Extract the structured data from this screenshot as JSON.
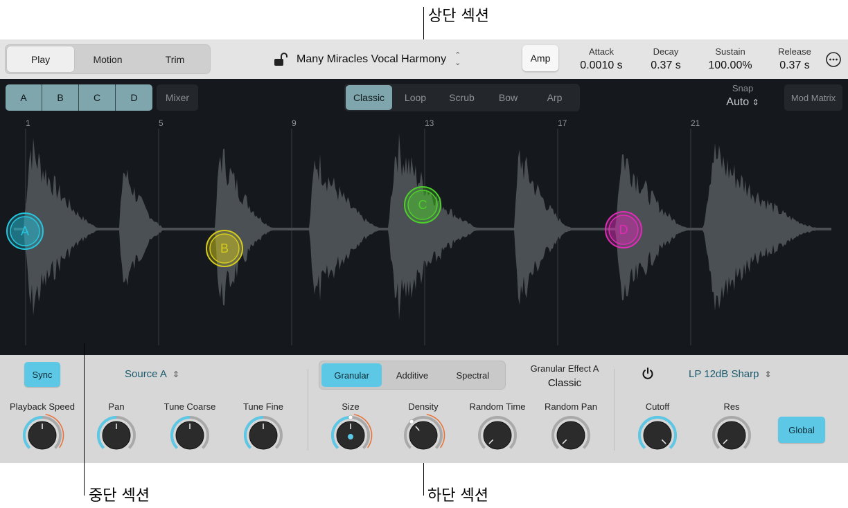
{
  "callouts": {
    "top": "상단 섹션",
    "middle": "중단 섹션",
    "bottom": "하단 섹션"
  },
  "topbar": {
    "modes": [
      "Play",
      "Motion",
      "Trim"
    ],
    "active_mode": "Play",
    "preset_name": "Many Miracles Vocal Harmony",
    "amp_label": "Amp",
    "params": [
      {
        "label": "Attack",
        "value": "0.0010 s"
      },
      {
        "label": "Decay",
        "value": "0.37 s"
      },
      {
        "label": "Sustain",
        "value": "100.00%"
      },
      {
        "label": "Release",
        "value": "0.37 s"
      }
    ]
  },
  "middle": {
    "sources": [
      "A",
      "B",
      "C",
      "D"
    ],
    "mixer_label": "Mixer",
    "play_modes": [
      "Classic",
      "Loop",
      "Scrub",
      "Bow",
      "Arp"
    ],
    "active_play_mode": "Classic",
    "snap_label": "Snap",
    "snap_value": "Auto",
    "mod_matrix_label": "Mod Matrix",
    "ruler": [
      "1",
      "5",
      "9",
      "13",
      "17",
      "21"
    ],
    "markers": [
      {
        "label": "A",
        "color": "#26c6e0"
      },
      {
        "label": "B",
        "color": "#d6cc1e"
      },
      {
        "label": "C",
        "color": "#4ccf2a"
      },
      {
        "label": "D",
        "color": "#e02bb8"
      }
    ]
  },
  "bottom": {
    "sync_label": "Sync",
    "source_select": "Source A",
    "engine_modes": [
      "Granular",
      "Additive",
      "Spectral"
    ],
    "active_engine": "Granular",
    "effect_label": "Granular Effect A",
    "effect_value": "Classic",
    "filter_type": "LP 12dB Sharp",
    "global_label": "Global",
    "knobs": [
      {
        "label": "Playback Speed",
        "level": 0.5
      },
      {
        "label": "Pan",
        "level": 0.5
      },
      {
        "label": "Tune Coarse",
        "level": 0.5
      },
      {
        "label": "Tune Fine",
        "level": 0.5
      },
      {
        "label": "Size",
        "level": 0.5
      },
      {
        "label": "Density",
        "level": 0.35
      },
      {
        "label": "Random Time",
        "level": 0.0
      },
      {
        "label": "Random Pan",
        "level": 0.0
      },
      {
        "label": "Cutoff",
        "level": 1.0
      },
      {
        "label": "Res",
        "level": 0.0
      }
    ]
  },
  "colors": {
    "accent": "#5cc8e6",
    "panel_dark": "#15181c",
    "panel_light": "#d7d7d7",
    "modulation": "#e8733a"
  }
}
